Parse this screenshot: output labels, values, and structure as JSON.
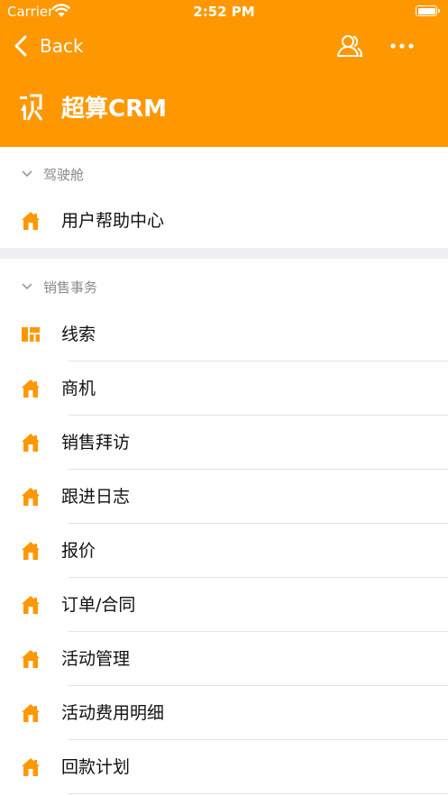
{
  "status_bar": {
    "carrier": "Carrier",
    "time": "2:52 PM"
  },
  "nav": {
    "back_label": "Back",
    "user_icon": "user-icon",
    "more_icon": "more-icon"
  },
  "brand": {
    "title": "超算CRM",
    "color": "#ff9800"
  },
  "sections": [
    {
      "title": "驾驶舱",
      "items": [
        {
          "label": "用户帮助中心",
          "icon": "home-icon"
        }
      ]
    },
    {
      "title": "销售事务",
      "items": [
        {
          "label": "线索",
          "icon": "grid-icon"
        },
        {
          "label": "商机",
          "icon": "home-icon"
        },
        {
          "label": "销售拜访",
          "icon": "home-icon"
        },
        {
          "label": "跟进日志",
          "icon": "home-icon"
        },
        {
          "label": "报价",
          "icon": "home-icon"
        },
        {
          "label": "订单/合同",
          "icon": "home-icon"
        },
        {
          "label": "活动管理",
          "icon": "home-icon"
        },
        {
          "label": "活动费用明细",
          "icon": "home-icon"
        },
        {
          "label": "回款计划",
          "icon": "home-icon"
        }
      ]
    }
  ],
  "colors": {
    "accent": "#ff9800",
    "section_title": "#8a8a8a",
    "separator": "#e3e3e3"
  }
}
